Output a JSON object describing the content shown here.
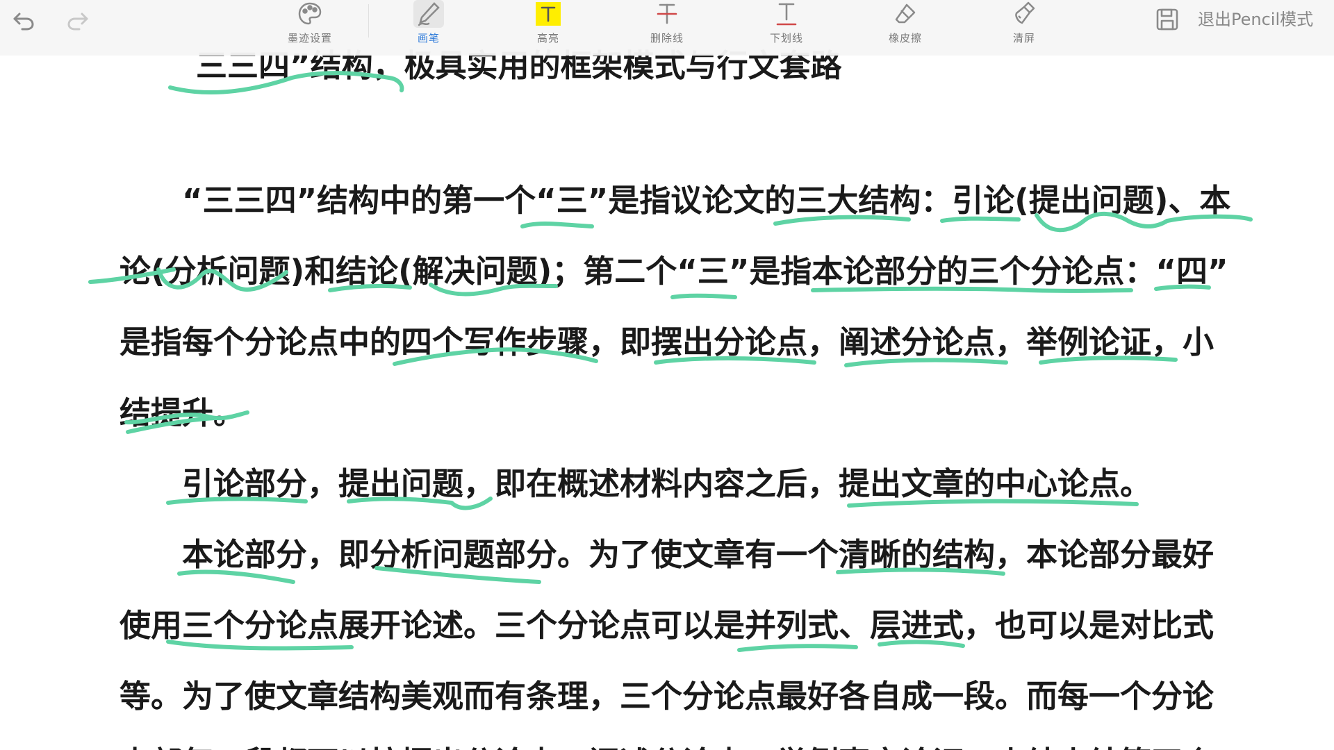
{
  "toolbar": {
    "tools": [
      {
        "label": "墨迹设置",
        "icon": "palette-icon"
      },
      {
        "label": "画笔",
        "icon": "pen-icon",
        "active": true
      },
      {
        "label": "高亮",
        "icon": "highlight-icon"
      },
      {
        "label": "删除线",
        "icon": "strikethrough-icon"
      },
      {
        "label": "下划线",
        "icon": "underline-icon"
      },
      {
        "label": "橡皮擦",
        "icon": "eraser-icon"
      },
      {
        "label": "清屏",
        "icon": "clear-screen-icon"
      }
    ],
    "exit_label": "退出Pencil模式",
    "active_color": "#2f7bd9",
    "highlight_color": "#ffee00"
  },
  "document": {
    "heading_partial": "三三四”结构，极具实用的框架模式与行文套路",
    "lines": [
      "“三三四”结构中的第一个“三”是指议论文的三大结构：引论(提出问题)、本",
      "论(分析问题)和结论(解决问题)；第二个“三”是指本论部分的三个分论点：“四”",
      "是指每个分论点中的四个写作步骤，即摆出分论点，阐述分论点，举例论证，小",
      "结提升。",
      "引论部分，提出问题，即在概述材料内容之后，提出文章的中心论点。",
      "本论部分，即分析问题部分。为了使文章有一个清晰的结构，本论部分最好",
      "使用三个分论点展开论述。三个分论点可以是并列式、层进式，也可以是对比式",
      "等。为了使文章结构美观而有条理，三个分论点最好各自成一段。而每一个分论",
      "点部每一段都可以按摆出分论点、阐述分论点、举例事实论证、小结小结等四个"
    ]
  },
  "ink_color": "#5ed3a4"
}
